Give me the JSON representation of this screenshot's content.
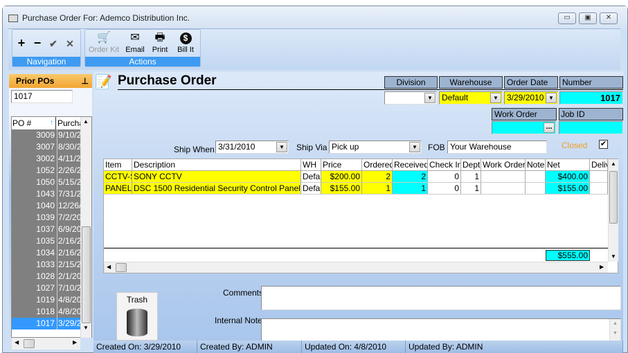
{
  "window": {
    "title": "Purchase Order For:  Ademco Distribution Inc."
  },
  "ribbon": {
    "navigation": {
      "label": "Navigation",
      "buttons": [
        "+",
        "−",
        "✔",
        "✕"
      ]
    },
    "actions": {
      "label": "Actions",
      "buttons": [
        {
          "label": "Order Kit",
          "icon": "cart-icon",
          "enabled": false
        },
        {
          "label": "Email",
          "icon": "envelope-icon"
        },
        {
          "label": "Print",
          "icon": "printer-icon"
        },
        {
          "label": "Bill It",
          "icon": "dollar-icon"
        }
      ]
    }
  },
  "prior_pos": {
    "title": "Prior POs",
    "search_value": "1017",
    "columns": [
      "PO #",
      "Purcha"
    ],
    "rows": [
      [
        "3009",
        "9/10/2"
      ],
      [
        "3007",
        "8/30/2"
      ],
      [
        "3002",
        "4/11/2"
      ],
      [
        "1052",
        "2/26/2"
      ],
      [
        "1050",
        "5/15/2"
      ],
      [
        "1043",
        "7/31/2"
      ],
      [
        "1040",
        "12/26/"
      ],
      [
        "1039",
        "7/2/20"
      ],
      [
        "1037",
        "6/9/20"
      ],
      [
        "1035",
        "2/16/2"
      ],
      [
        "1034",
        "2/16/2"
      ],
      [
        "1033",
        "2/15/2"
      ],
      [
        "1028",
        "2/1/20"
      ],
      [
        "1027",
        "7/10/2"
      ],
      [
        "1019",
        "4/8/20"
      ],
      [
        "1018",
        "4/8/20"
      ],
      [
        "1017",
        "3/29/2"
      ]
    ],
    "selected": "1017"
  },
  "form": {
    "title": "Purchase Order",
    "division": {
      "label": "Division",
      "value": ""
    },
    "warehouse": {
      "label": "Warehouse",
      "value": "Default"
    },
    "order_date": {
      "label": "Order Date",
      "value": "3/29/2010"
    },
    "number": {
      "label": "Number",
      "value": "1017"
    },
    "work_order": {
      "label": "Work Order",
      "value": ""
    },
    "job_id": {
      "label": "Job ID",
      "value": ""
    },
    "ship_when": {
      "label": "Ship When",
      "value": "3/31/2010"
    },
    "ship_via": {
      "label": "Ship Via",
      "value": "Pick up"
    },
    "fob": {
      "label": "FOB",
      "value": "Your Warehouse"
    },
    "closed": {
      "label": "Closed",
      "checked": true
    }
  },
  "lines": {
    "columns": [
      "Item",
      "Description",
      "WH",
      "Price",
      "Ordered",
      "Received",
      "Check In",
      "Dept",
      "Work Order",
      "Note",
      "Net",
      "Deliv"
    ],
    "rows": [
      [
        "CCTV-S",
        "SONY CCTV",
        "Defau",
        "$200.00",
        "2",
        "2",
        "0",
        "1",
        "",
        "",
        "$400.00",
        ""
      ],
      [
        "PANEL-",
        "DSC 1500 Residential Security Control Panel",
        "Defau",
        "$155.00",
        "1",
        "1",
        "0",
        "1",
        "",
        "",
        "$155.00",
        ""
      ]
    ],
    "total_net": "$555.00"
  },
  "trash": {
    "label": "Trash"
  },
  "comments": {
    "label": "Comments",
    "value": ""
  },
  "internal_note": {
    "label": "Internal Note",
    "value": ""
  },
  "status": {
    "created_on": "Created On: 3/29/2010",
    "created_by": "Created By: ADMIN",
    "updated_on": "Updated On: 4/8/2010",
    "updated_by": "Updated By: ADMIN"
  },
  "colors": {
    "required": "#ffff00",
    "computed": "#00ffff",
    "header_accent": "#f1a531",
    "group_label": "#3d9bf2",
    "closed_label": "#f0a020"
  }
}
